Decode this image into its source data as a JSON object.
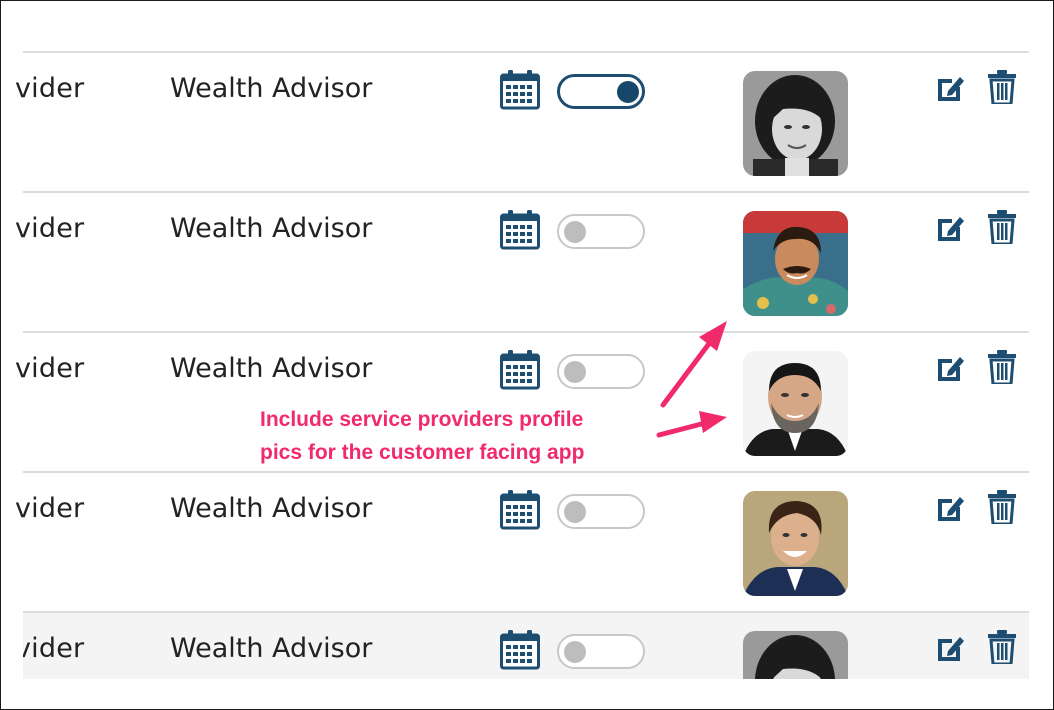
{
  "rows": [
    {
      "role": "vider",
      "title": "Wealth Advisor",
      "toggle": "on",
      "avatar": "woman"
    },
    {
      "role": "vider",
      "title": "Wealth Advisor",
      "toggle": "off",
      "avatar": "mustache-man"
    },
    {
      "role": "vider",
      "title": "Wealth Advisor",
      "toggle": "off",
      "avatar": "bearded-man"
    },
    {
      "role": "vider",
      "title": "Wealth Advisor",
      "toggle": "off",
      "avatar": "young-man"
    },
    {
      "role": "vider",
      "title": "Wealth Advisor",
      "toggle": "off",
      "avatar": "woman"
    }
  ],
  "annotation": {
    "line1": "Include service providers profile",
    "line2": "pics for the customer facing app"
  },
  "icons": {
    "calendar": "calendar-icon",
    "edit": "edit-icon",
    "delete": "trash-icon"
  },
  "colors": {
    "accent": "#1e4d72",
    "annotation": "#f12a6b"
  }
}
